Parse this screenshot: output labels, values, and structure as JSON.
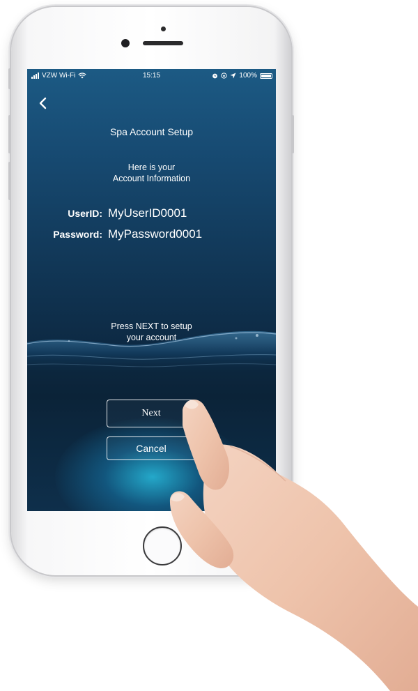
{
  "status_bar": {
    "carrier": "VZW Wi-Fi",
    "time": "15:15",
    "battery": "100%",
    "battery_level": 1.0,
    "icons": [
      "signal-icon",
      "wifi-icon",
      "alarm-icon",
      "orientation-lock-icon",
      "location-icon",
      "battery-icon"
    ]
  },
  "header": {
    "back_icon": "chevron-left-icon",
    "title": "Spa Account Setup"
  },
  "intro": {
    "line1": "Here is your",
    "line2": "Account Information"
  },
  "credentials": {
    "userid_label": "UserID:",
    "userid_value": "MyUserID0001",
    "password_label": "Password:",
    "password_value": "MyPassword0001"
  },
  "instructions": {
    "line1": "Press NEXT to setup",
    "line2": "your account"
  },
  "buttons": {
    "next_label": "Next",
    "cancel_label": "Cancel"
  },
  "colors": {
    "screen_top": "#1c5a84",
    "screen_bottom": "#0b2338",
    "glow": "#28bee1",
    "text": "#ffffff"
  }
}
